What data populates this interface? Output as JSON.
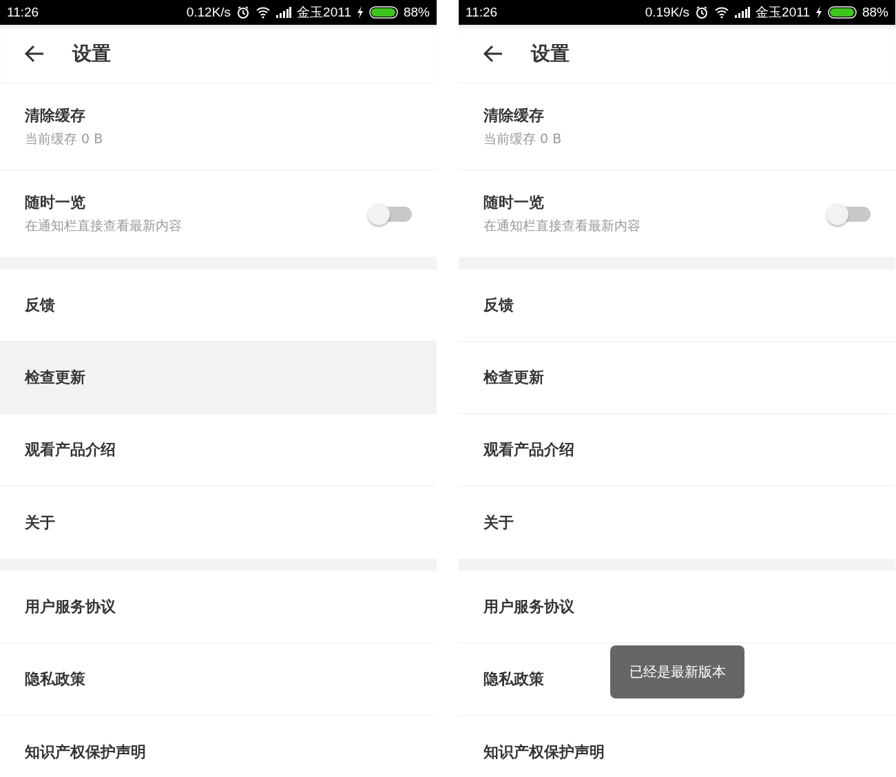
{
  "screens": [
    {
      "status_bar": {
        "time": "11:26",
        "speed": "0.12K/s",
        "carrier": "金玉2011",
        "battery": "88%"
      },
      "title": "设置",
      "groups": [
        [
          {
            "kind": "subtitle",
            "title": "清除缓存",
            "subtitle": "当前缓存 0 B",
            "selected": false
          },
          {
            "kind": "toggle",
            "title": "随时一览",
            "subtitle": "在通知栏直接查看最新内容",
            "on": false,
            "selected": false
          }
        ],
        [
          {
            "kind": "plain",
            "title": "反馈",
            "selected": false
          },
          {
            "kind": "plain",
            "title": "检查更新",
            "selected": true
          },
          {
            "kind": "plain",
            "title": "观看产品介绍",
            "selected": false
          },
          {
            "kind": "plain",
            "title": "关于",
            "selected": false
          }
        ],
        [
          {
            "kind": "plain",
            "title": "用户服务协议",
            "selected": false
          },
          {
            "kind": "plain",
            "title": "隐私政策",
            "selected": false
          },
          {
            "kind": "plain",
            "title": "知识产权保护声明",
            "selected": false
          }
        ]
      ]
    },
    {
      "status_bar": {
        "time": "11:26",
        "speed": "0.19K/s",
        "carrier": "金玉2011",
        "battery": "88%"
      },
      "title": "设置",
      "toast": "已经是最新版本",
      "groups": [
        [
          {
            "kind": "subtitle",
            "title": "清除缓存",
            "subtitle": "当前缓存 0 B",
            "selected": false
          },
          {
            "kind": "toggle",
            "title": "随时一览",
            "subtitle": "在通知栏直接查看最新内容",
            "on": false,
            "selected": false
          }
        ],
        [
          {
            "kind": "plain",
            "title": "反馈",
            "selected": false
          },
          {
            "kind": "plain",
            "title": "检查更新",
            "selected": false
          },
          {
            "kind": "plain",
            "title": "观看产品介绍",
            "selected": false
          },
          {
            "kind": "plain",
            "title": "关于",
            "selected": false
          }
        ],
        [
          {
            "kind": "plain",
            "title": "用户服务协议",
            "selected": false
          },
          {
            "kind": "plain",
            "title": "隐私政策",
            "selected": false
          },
          {
            "kind": "plain",
            "title": "知识产权保护声明",
            "selected": false
          }
        ]
      ]
    }
  ]
}
